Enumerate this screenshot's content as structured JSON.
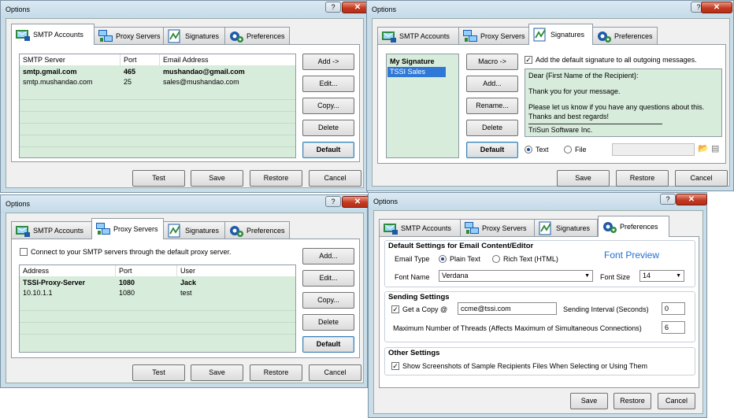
{
  "colors": {
    "accent": "#1f6fd0",
    "list_bg": "#d8ecdc",
    "close": "#c43a22"
  },
  "icons": {
    "close": "close-icon",
    "minimize": "minimize-icon",
    "smtp": "smtp-accounts-icon",
    "proxy": "proxy-servers-icon",
    "signatures": "signatures-icon",
    "preferences": "preferences-icon"
  },
  "windows": {
    "title": "Options",
    "help": "?",
    "close": "✕",
    "tabs": {
      "smtp": "SMTP Accounts",
      "proxy": "Proxy Servers",
      "signatures": "Signatures",
      "preferences": "Preferences"
    },
    "footer": {
      "test": "Test",
      "save": "Save",
      "restore": "Restore",
      "cancel": "Cancel"
    }
  },
  "smtp": {
    "headers": {
      "server": "SMTP Server",
      "port": "Port",
      "email": "Email Address"
    },
    "rows": [
      {
        "server": "smtp.gmail.com",
        "port": "465",
        "email": "mushandao@gmail.com"
      },
      {
        "server": "smtp.mushandao.com",
        "port": "25",
        "email": "sales@mushandao.com"
      }
    ],
    "buttons": {
      "add": "Add ->",
      "edit": "Edit...",
      "copy": "Copy...",
      "delete": "Delete",
      "default": "Default"
    }
  },
  "signatures": {
    "list": [
      "My Signature",
      "TSSI Sales"
    ],
    "buttons": {
      "macro": "Macro ->",
      "add": "Add...",
      "rename": "Rename...",
      "delete": "Delete",
      "default": "Default"
    },
    "add_default_label": "Add the default signature to all outgoing messages.",
    "body": {
      "line1": "Dear {First Name of the Recipient}:",
      "line2": "Thank you for your message.",
      "line3": "Please let us know if you have any questions about this.",
      "line4": "Thanks and best regards!",
      "line5": "TriSun Software Inc."
    },
    "text_label": "Text",
    "file_label": "File"
  },
  "proxy": {
    "connect_label": "Connect to your SMTP servers through the default proxy server.",
    "headers": {
      "address": "Address",
      "port": "Port",
      "user": "User"
    },
    "rows": [
      {
        "address": "TSSI-Proxy-Server",
        "port": "1080",
        "user": "Jack"
      },
      {
        "address": "10.10.1.1",
        "port": "1080",
        "user": "test"
      }
    ],
    "buttons": {
      "add": "Add...",
      "edit": "Edit...",
      "copy": "Copy...",
      "delete": "Delete",
      "default": "Default"
    }
  },
  "preferences": {
    "default_settings": "Default Settings for Email Content/Editor",
    "email_type": "Email Type",
    "plain_text": "Plain Text",
    "rich_text": "Rich Text (HTML)",
    "font_preview": "Font Preview",
    "font_name_label": "Font Name",
    "font_name": "Verdana",
    "font_size_label": "Font Size",
    "font_size": "14",
    "sending_settings": "Sending Settings",
    "get_copy": "Get a Copy @",
    "copy_email": "ccme@tssi.com",
    "sending_interval": "Sending Interval (Seconds)",
    "interval": "0",
    "max_threads": "Maximum Number of Threads (Affects Maximum of Simultaneous Connections)",
    "threads": "6",
    "other_settings": "Other Settings",
    "show_screenshots": "Show Screenshots of Sample Recipients Files When Selecting or Using Them"
  }
}
